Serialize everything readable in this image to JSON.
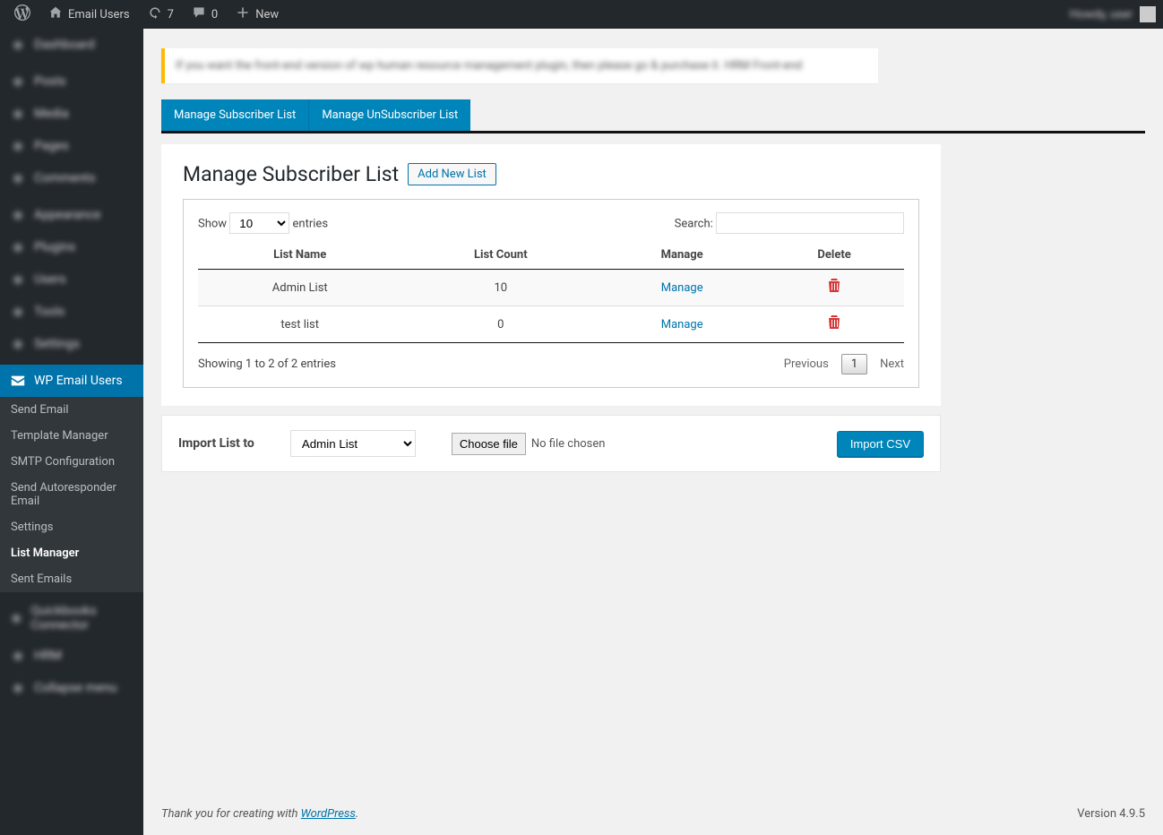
{
  "adminbar": {
    "site_name": "Email Users",
    "updates_count": "7",
    "comments_count": "0",
    "new_label": "New",
    "howdy_text": "Howdy, user"
  },
  "sidebar": {
    "blurred_items": [
      "Dashboard",
      "Posts",
      "Media",
      "Pages",
      "Comments",
      "Appearance",
      "Plugins",
      "Users",
      "Tools",
      "Settings"
    ],
    "active_label": "WP Email Users",
    "submenu": [
      {
        "label": "Send Email",
        "current": false
      },
      {
        "label": "Template Manager",
        "current": false
      },
      {
        "label": "SMTP Configuration",
        "current": false
      },
      {
        "label": "Send Autoresponder Email",
        "current": false
      },
      {
        "label": "Settings",
        "current": false
      },
      {
        "label": "List Manager",
        "current": true
      },
      {
        "label": "Sent Emails",
        "current": false
      }
    ],
    "blurred_bottom": [
      "Quickbooks Connector",
      "HRM",
      "Collapse menu"
    ]
  },
  "notice_text": "If you want the front-end version of wp human resource management plugin, then please go & purchase it. HRM Front-end",
  "tabs": {
    "subscriber": "Manage Subscriber List",
    "unsubscriber": "Manage UnSubscriber List"
  },
  "page": {
    "title": "Manage Subscriber List",
    "add_new": "Add New List"
  },
  "datatable": {
    "show_label_pre": "Show",
    "show_value": "10",
    "show_label_post": "entries",
    "search_label": "Search:",
    "columns": [
      "List Name",
      "List Count",
      "Manage",
      "Delete"
    ],
    "rows": [
      {
        "name": "Admin List",
        "count": "10",
        "manage": "Manage"
      },
      {
        "name": "test list",
        "count": "0",
        "manage": "Manage"
      }
    ],
    "info": "Showing 1 to 2 of 2 entries",
    "prev": "Previous",
    "page1": "1",
    "next": "Next"
  },
  "import": {
    "label": "Import List to",
    "select_value": "Admin List",
    "choose_file": "Choose file",
    "no_file": "No file chosen",
    "button": "Import CSV"
  },
  "footer": {
    "thank_pre": "Thank you for creating with ",
    "wp_link": "WordPress",
    "thank_post": ".",
    "version": "Version 4.9.5"
  }
}
